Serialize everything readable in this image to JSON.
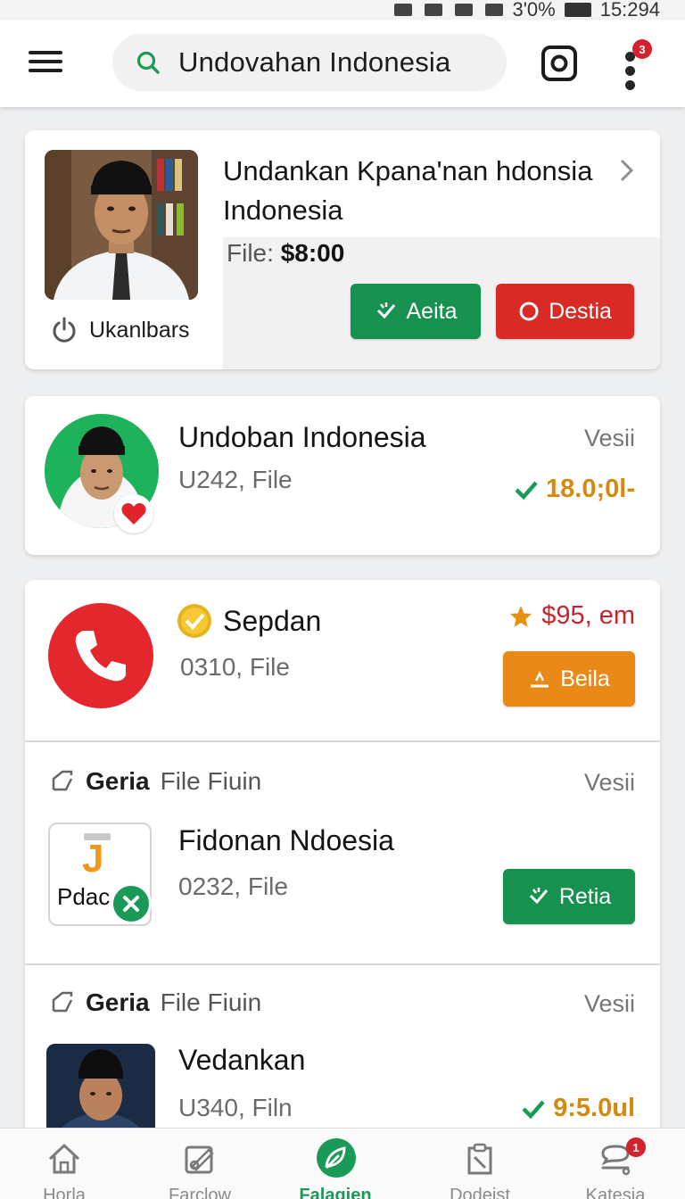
{
  "status_bar": {
    "battery": "3'0%",
    "time": "15:294"
  },
  "search": {
    "query": "Undovahan Indonesia"
  },
  "header": {
    "notification_count": "3"
  },
  "card1": {
    "title_line1": "Undankan Kpana'nan hdonsia",
    "title_line2": "Indonesia",
    "file_label": "File:",
    "file_price": "$8:00",
    "creator_name": "Ukanlbars",
    "accept_label": "Aeita",
    "reject_label": "Destia"
  },
  "card2": {
    "title": "Undoban Indonesia",
    "subtitle": "U242, File",
    "tag": "Vesii",
    "price": "18.0;0l-"
  },
  "card3": {
    "title": "Sepdan",
    "subtitle": "0310, File",
    "price": "$95, em",
    "button_label": "Beila"
  },
  "card4": {
    "section_bold": "Geria",
    "section_rest": "File Fiuin",
    "tag": "Vesii",
    "title": "Fidonan Ndoesia",
    "subtitle": "0232, File",
    "button_label": "Retia",
    "icon_text": "Pdac",
    "icon_letter": "J"
  },
  "card5": {
    "section_bold": "Geria",
    "section_rest": "File Fiuin",
    "tag": "Vesii",
    "title": "Vedankan",
    "subtitle": "U340, Filn",
    "price": "9:5.0ul"
  },
  "bottom_nav": {
    "items": [
      {
        "label": "Horla",
        "icon": "home-icon"
      },
      {
        "label": "Farclow",
        "icon": "edit-image-icon"
      },
      {
        "label": "Falagien",
        "icon": "leaf-icon"
      },
      {
        "label": "Dodeist",
        "icon": "clipboard-icon"
      },
      {
        "label": "Katesia",
        "icon": "chat-icon",
        "badge": "1"
      }
    ]
  },
  "colors": {
    "accent_green": "#16914f",
    "danger_red": "#d92b25",
    "warning_orange": "#e98a18",
    "price_gold": "#d48a0e"
  }
}
